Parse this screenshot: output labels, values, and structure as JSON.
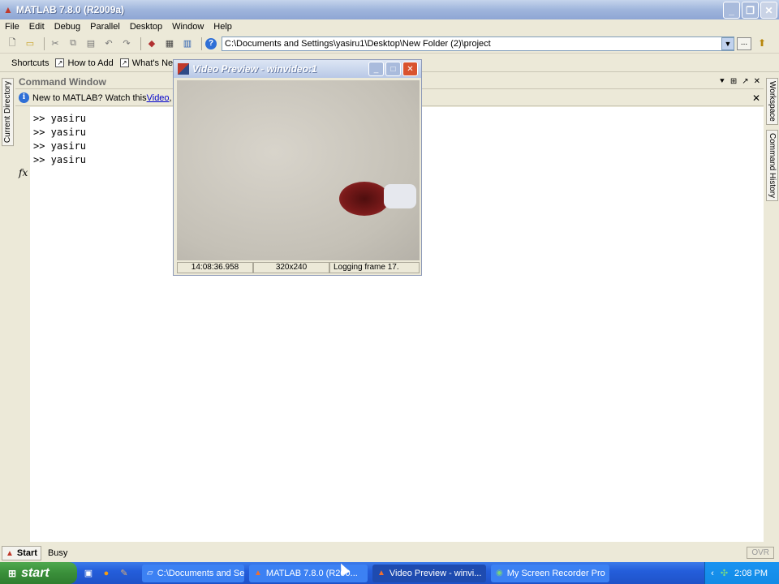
{
  "window": {
    "title": "MATLAB  7.8.0 (R2009a)"
  },
  "menu": [
    "File",
    "Edit",
    "Debug",
    "Parallel",
    "Desktop",
    "Window",
    "Help"
  ],
  "toolbar": {
    "path": "C:\\Documents and Settings\\yasiru1\\Desktop\\New Folder (2)\\project",
    "browse_label": "..."
  },
  "shortcuts": {
    "label": "Shortcuts",
    "items": [
      "How to Add",
      "What's New"
    ]
  },
  "side_tabs": {
    "left": "Current Directory",
    "right_top": "Workspace",
    "right_bottom": "Command History"
  },
  "command_window": {
    "title": "Command Window",
    "info_prefix": "New to MATLAB? Watch this ",
    "info_link": "Video",
    "info_suffix": ", se",
    "prompt_symbol": "fx",
    "lines": [
      ">> yasiru",
      ">> yasiru",
      ">> yasiru",
      ">> yasiru"
    ]
  },
  "status": {
    "start_label": "Start",
    "busy": "Busy",
    "ovr": "OVR"
  },
  "video_preview": {
    "title": "Video Preview - winvideo:1",
    "timestamp": "14:08:36.958",
    "resolution": "320x240",
    "logging": "Logging frame 17."
  },
  "taskbar": {
    "start": "start",
    "tasks": [
      "C:\\Documents and Se...",
      "MATLAB  7.8.0 (R200...",
      "Video Preview - winvi...",
      "My Screen Recorder Pro"
    ],
    "clock": "2:08 PM"
  }
}
